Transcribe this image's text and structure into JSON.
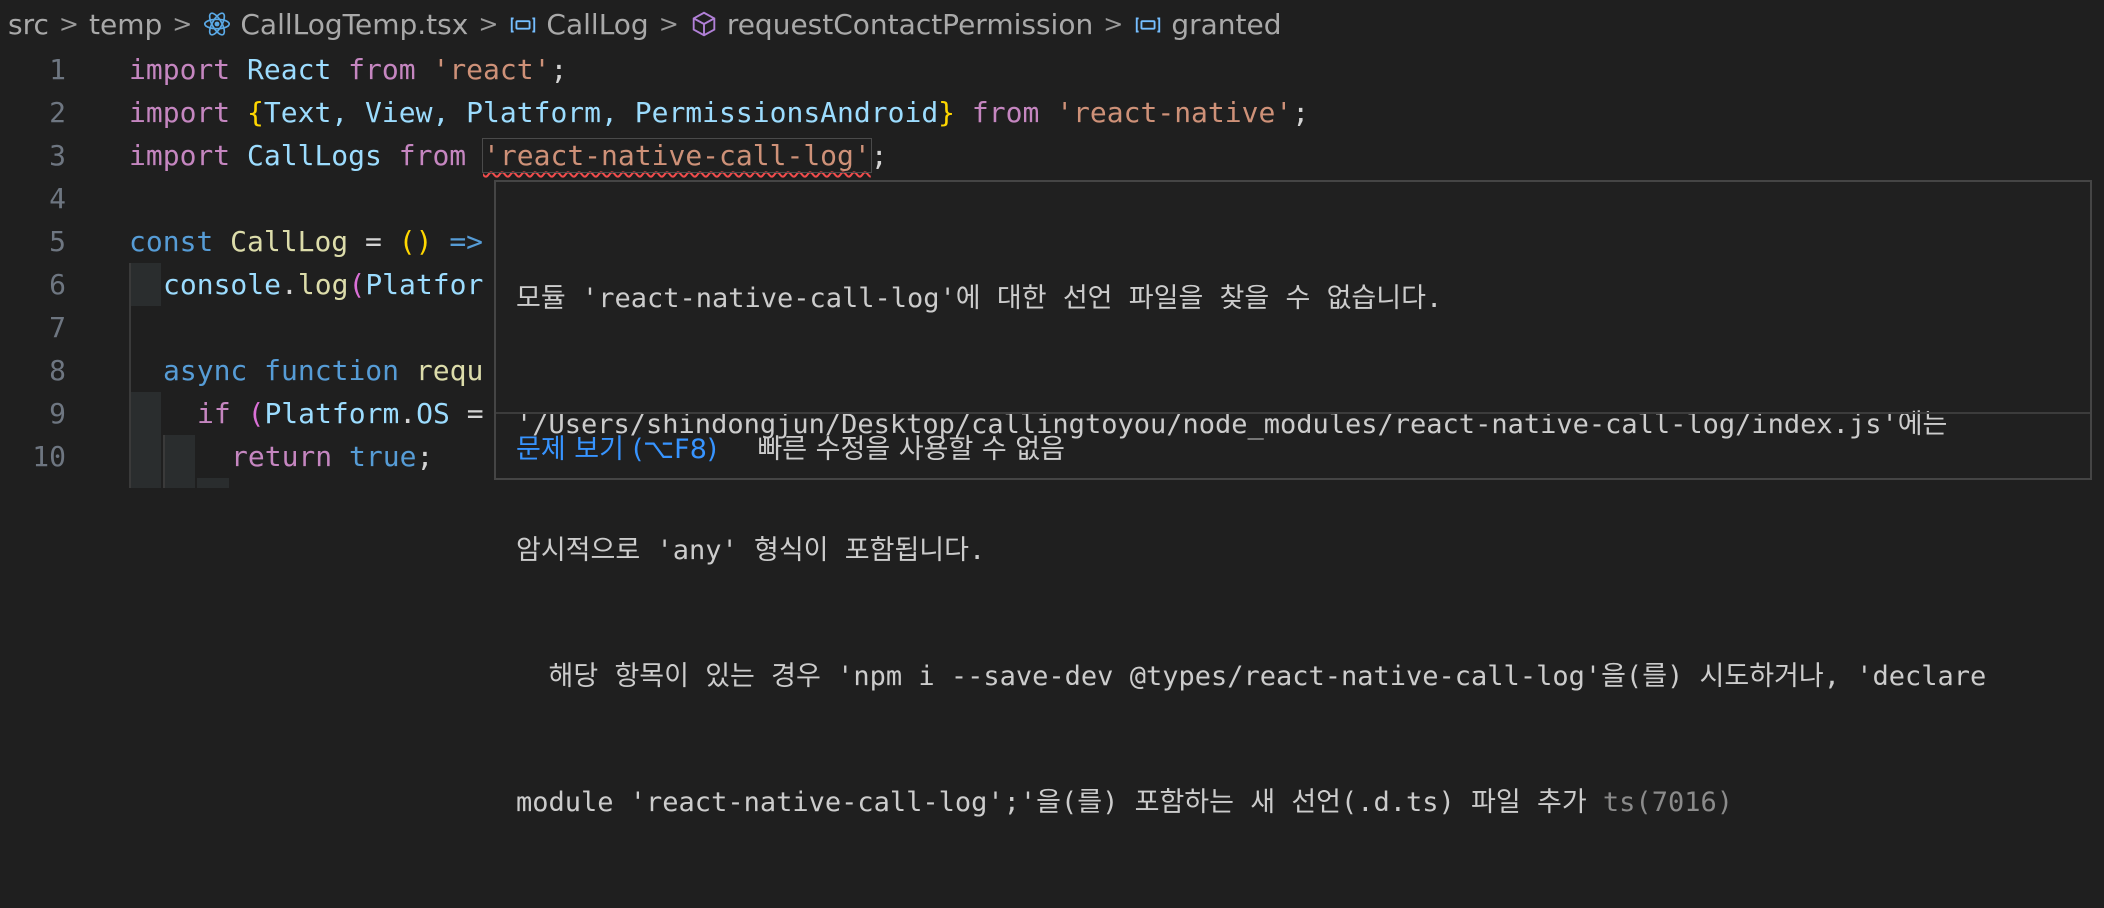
{
  "breadcrumb": {
    "items": [
      "src",
      "temp",
      "CallLogTemp.tsx",
      "CallLog",
      "requestContactPermission",
      "granted"
    ],
    "separator": ">"
  },
  "editor": {
    "line_numbers": [
      "1",
      "2",
      "3",
      "4",
      "5",
      "6",
      "7",
      "8",
      "9",
      "10"
    ],
    "lines": {
      "l1": {
        "t1": "import",
        "t2": "React",
        "t3": "from",
        "t4": "'react'",
        "t5": ";"
      },
      "l2": {
        "t1": "import",
        "t2": "{",
        "t3": "Text, View, Platform, PermissionsAndroid",
        "t4": "}",
        "t5": "from",
        "t6": "'react-native'",
        "t7": ";"
      },
      "l3": {
        "t1": "import",
        "t2": "CallLogs",
        "t3": "from",
        "t4": "'react-native-call-log'",
        "t5": ";"
      },
      "l5": {
        "t1": "const",
        "t2": "CallLog",
        "t3": "=",
        "t4": "()",
        "t5": "=>"
      },
      "l6": {
        "t1": "console",
        "t2": ".",
        "t3": "log",
        "t4": "(",
        "t5": "Platfor"
      },
      "l8": {
        "t1": "async",
        "t2": "function",
        "t3": "requ"
      },
      "l9": {
        "t1": "if",
        "t2": "(",
        "t3": "Platform",
        "t4": ".",
        "t5": "OS",
        "t6": "="
      },
      "l10": {
        "t1": "return",
        "t2": "true",
        "t3": ";"
      }
    }
  },
  "hover": {
    "line1": "모듈 'react-native-call-log'에 대한 선언 파일을 찾을 수 없습니다.",
    "line2": "'/Users/shindongjun/Desktop/callingtoyou/node_modules/react-native-call-log/index.js'에는",
    "line3": "암시적으로 'any' 형식이 포함됩니다.",
    "line4": "  해당 항목이 있는 경우 'npm i --save-dev @types/react-native-call-log'을(를) 시도하거나, 'declare",
    "line5a": "module 'react-native-call-log';'을(를) 포함하는 새 선언(.d.ts) 파일 추가 ",
    "line5b": "ts(7016)",
    "view_problem": "문제 보기 (⌥F8)",
    "no_quick_fix": "빠른 수정을 사용할 수 없음"
  },
  "colors": {
    "background": "#1f1f1f",
    "keyword": "#c586c0",
    "string": "#ce9178",
    "variable": "#9cdcfe",
    "function": "#dcdcaa",
    "error": "#f14c4c",
    "link": "#3794ff"
  }
}
